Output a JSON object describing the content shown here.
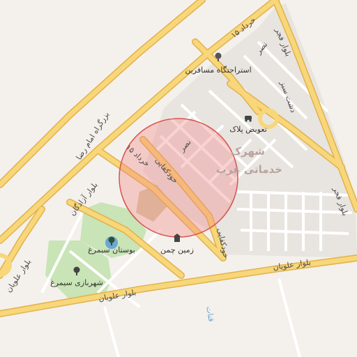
{
  "map": {
    "colors": {
      "background": "#f4f1ec",
      "major_road": "#f6d36b",
      "major_road_outline": "#e3b04b",
      "minor_road": "#ffffff",
      "urban_area": "#e6e3de",
      "park": "#c8e6b4",
      "sand_lot": "#d8c9a5",
      "water": "#6aa6d6",
      "highlight_circle_fill": "#f08080",
      "highlight_circle_stroke": "#d9534f"
    },
    "highlight": {
      "shape": "circle",
      "description_icon": "location-radius-circle"
    }
  },
  "labels": {
    "road_15_khordad_top": "۱۵ خرداد",
    "road_15_khordad_mid": "۱۵ خرداد",
    "road_nasr_top": "نصر",
    "road_nasr_mid": "نصر",
    "road_bolvar_fajr_top": "بلوار فجر",
    "road_bolvar_fajr_right": "بلوار فجر",
    "road_shahrak_sign": "دشت سبز",
    "road_imam_reza": "بزرگراه امام رضا",
    "road_bolvar_azadegan": "بلوار آزادگان",
    "road_khodkafaei_1": "خودکفایی",
    "road_khodkafaei_2": "خودکفایی",
    "road_bolvar_alavian_left": "بلوار علویان",
    "road_bolvar_alavian_mid": "بلوار علویان",
    "road_bolvar_alavian_right": "بلوار علویان",
    "area_shahrak": "شهرک",
    "area_khadamati": "خدماتی غرب",
    "water_qanat": "قنات"
  },
  "pois": [
    {
      "name": "استراحتگاه مسافرین",
      "icon": "tree-icon"
    },
    {
      "name": "تعویض پلاک",
      "icon": "car-icon"
    },
    {
      "name": "بوستان سیمرغ",
      "icon": "tree-icon"
    },
    {
      "name": "زمین چمن",
      "icon": "building-icon"
    },
    {
      "name": "شهربازی سیمرغ",
      "icon": "tree-icon"
    }
  ]
}
